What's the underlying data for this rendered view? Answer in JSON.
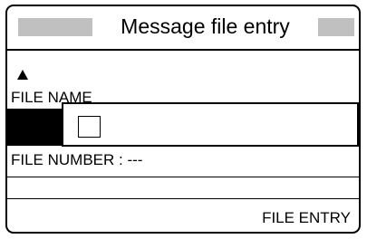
{
  "dialog": {
    "title": "Message file entry",
    "fields": {
      "file_name_label": "FILE NAME",
      "file_number_label": "FILE NUMBER : ---"
    },
    "footer": {
      "file_entry_label": "FILE ENTRY"
    }
  }
}
